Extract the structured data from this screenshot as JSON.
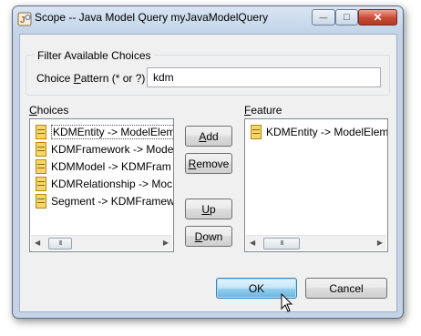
{
  "window": {
    "title": "Scope -- Java Model Query myJavaModelQuery",
    "minimize_glyph": "—",
    "maximize_glyph": "□",
    "close_glyph": "✕"
  },
  "filter": {
    "group_title": "Filter Available Choices",
    "label_prefix": "Choice ",
    "label_mnemonic": "P",
    "label_suffix": "attern (* or ?)",
    "value": "kdm"
  },
  "choices": {
    "label_mnemonic": "C",
    "label_rest": "hoices",
    "items": [
      "KDMEntity -> ModelElem",
      "KDMFramework -> Mode",
      "KDMModel -> KDMFram",
      "KDMRelationship -> Moc",
      "Segment -> KDMFramew"
    ]
  },
  "feature": {
    "label_mnemonic": "F",
    "label_rest": "eature",
    "items": [
      "KDMEntity -> ModelElem"
    ]
  },
  "buttons": {
    "add_m": "A",
    "add_r": "dd",
    "remove_m": "R",
    "remove_r": "emove",
    "up_m": "U",
    "up_r": "p",
    "down_m": "D",
    "down_r": "own",
    "ok": "OK",
    "cancel": "Cancel"
  },
  "scrollbar": {
    "left_arrow": "◀",
    "right_arrow": "▶",
    "thumb_grip": "III"
  },
  "colors": {
    "default_button_border": "#3c7fb1",
    "close_button": "#c74a33"
  }
}
